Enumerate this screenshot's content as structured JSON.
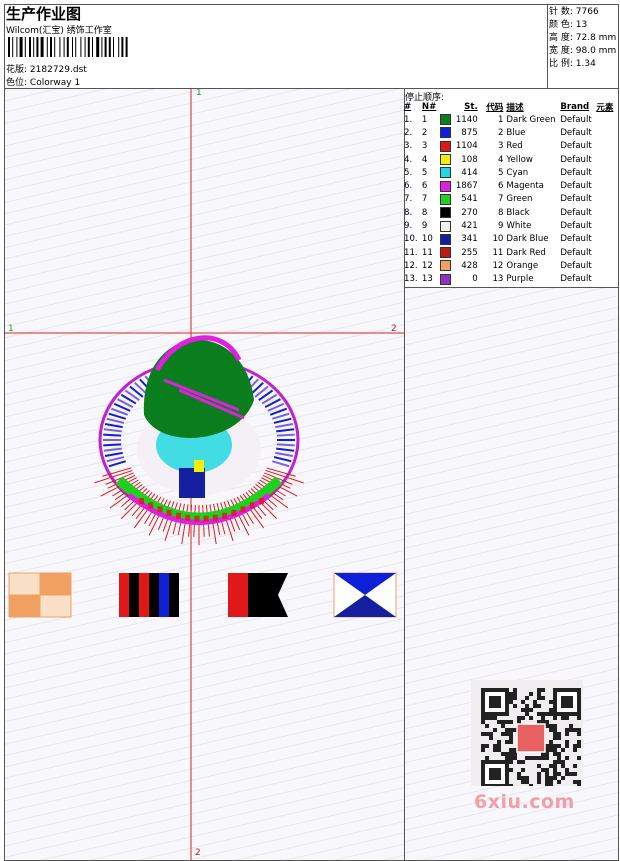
{
  "header": {
    "title": "生产作业图",
    "studio": "Wilcom(汇宝) 绣饰工作室",
    "design_label": "花版:",
    "design_value": "2182729.dst",
    "colorway_label": "色位:",
    "colorway_value": "Colorway 1"
  },
  "specs": [
    {
      "label": "针 数:",
      "value": "7766"
    },
    {
      "label": "颜 色:",
      "value": "13"
    },
    {
      "label": "高 度:",
      "value": "72.8 mm"
    },
    {
      "label": "宽 度:",
      "value": "98.0 mm"
    },
    {
      "label": "比 例:",
      "value": "1.34"
    }
  ],
  "stops": {
    "title": "停止顺序:",
    "columns": [
      "#",
      "N#",
      "St.",
      "代码",
      "描述",
      "Brand",
      "元素"
    ],
    "rows": [
      {
        "idx": "1.",
        "n": "1",
        "color": "#0a7d1c",
        "st": "1140",
        "code": "1",
        "desc": "Dark Green",
        "brand": "Default"
      },
      {
        "idx": "2.",
        "n": "2",
        "color": "#1020d8",
        "st": "875",
        "code": "2",
        "desc": "Blue",
        "brand": "Default"
      },
      {
        "idx": "3.",
        "n": "3",
        "color": "#e01818",
        "st": "1104",
        "code": "3",
        "desc": "Red",
        "brand": "Default"
      },
      {
        "idx": "4.",
        "n": "4",
        "color": "#f4f000",
        "st": "108",
        "code": "4",
        "desc": "Yellow",
        "brand": "Default"
      },
      {
        "idx": "5.",
        "n": "5",
        "color": "#22d8e0",
        "st": "414",
        "code": "5",
        "desc": "Cyan",
        "brand": "Default"
      },
      {
        "idx": "6.",
        "n": "6",
        "color": "#e020e0",
        "st": "1867",
        "code": "6",
        "desc": "Magenta",
        "brand": "Default"
      },
      {
        "idx": "7.",
        "n": "7",
        "color": "#20d020",
        "st": "541",
        "code": "7",
        "desc": "Green",
        "brand": "Default"
      },
      {
        "idx": "8.",
        "n": "8",
        "color": "#000000",
        "st": "270",
        "code": "8",
        "desc": "Black",
        "brand": "Default"
      },
      {
        "idx": "9.",
        "n": "9",
        "color": "#f2f2f2",
        "st": "421",
        "code": "9",
        "desc": "White",
        "brand": "Default"
      },
      {
        "idx": "10.",
        "n": "10",
        "color": "#1420a0",
        "st": "341",
        "code": "10",
        "desc": "Dark Blue",
        "brand": "Default"
      },
      {
        "idx": "11.",
        "n": "11",
        "color": "#c01818",
        "st": "255",
        "code": "11",
        "desc": "Dark Red",
        "brand": "Default"
      },
      {
        "idx": "12.",
        "n": "12",
        "color": "#f0a060",
        "st": "428",
        "code": "12",
        "desc": "Orange",
        "brand": "Default"
      },
      {
        "idx": "13.",
        "n": "13",
        "color": "#9030c0",
        "st": "0",
        "code": "13",
        "desc": "Purple",
        "brand": "Default"
      }
    ]
  },
  "markers": {
    "top": "1",
    "left": "1",
    "right": "2",
    "bottom": "2"
  },
  "watermark": {
    "site": "6xiu.com"
  }
}
